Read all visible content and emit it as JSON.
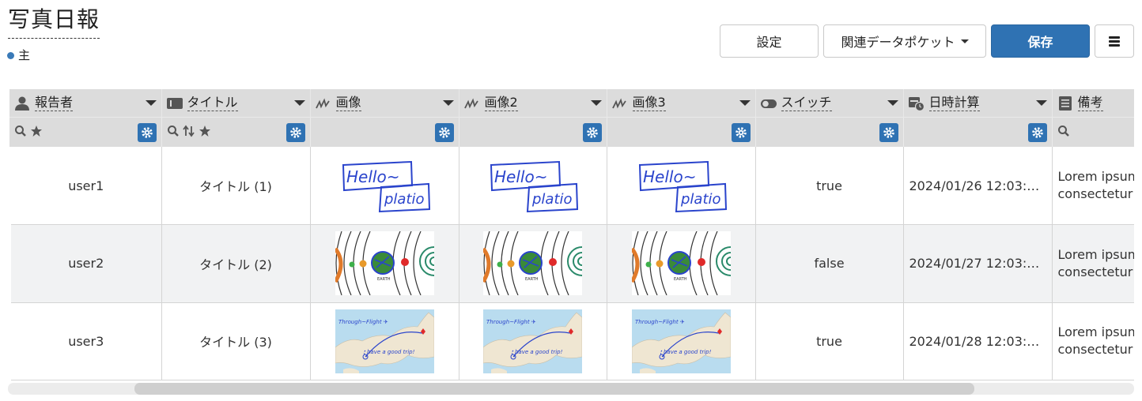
{
  "page": {
    "title": "写真日報",
    "subtitle": "主",
    "accent_color": "#2f72b3"
  },
  "toolbar": {
    "settings_label": "設定",
    "pocket_label": "関連データポケット",
    "save_label": "保存",
    "menu_icon": "hamburger-icon"
  },
  "table": {
    "columns": [
      {
        "label": "報告者",
        "icon": "person-icon"
      },
      {
        "label": "タイトル",
        "icon": "text-field-icon"
      },
      {
        "label": "画像",
        "icon": "signature-icon"
      },
      {
        "label": "画像2",
        "icon": "signature-icon"
      },
      {
        "label": "画像3",
        "icon": "signature-icon"
      },
      {
        "label": "スイッチ",
        "icon": "toggle-icon"
      },
      {
        "label": "日時計算",
        "icon": "calendar-clock-icon"
      },
      {
        "label": "備考",
        "icon": "document-icon"
      }
    ],
    "rows": [
      {
        "reporter": "user1",
        "title": "タイトル (1)",
        "images": [
          "hello-platio-image",
          "hello-platio-image",
          "hello-platio-image"
        ],
        "switch": "true",
        "datetime": "2024/01/26 12:03:…",
        "note_line1": "Lorem ipsum",
        "note_line2": "consectetur a"
      },
      {
        "reporter": "user2",
        "title": "タイトル (2)",
        "images": [
          "solar-system-image",
          "solar-system-image",
          "solar-system-image"
        ],
        "switch": "false",
        "datetime": "2024/01/27 12:03:…",
        "note_line1": "Lorem ipsum",
        "note_line2": "consectetur a"
      },
      {
        "reporter": "user3",
        "title": "タイトル (3)",
        "images": [
          "japan-flight-map-image",
          "japan-flight-map-image",
          "japan-flight-map-image"
        ],
        "switch": "true",
        "datetime": "2024/01/28 12:03:…",
        "note_line1": "Lorem ipsum",
        "note_line2": "consectetur a"
      }
    ]
  }
}
